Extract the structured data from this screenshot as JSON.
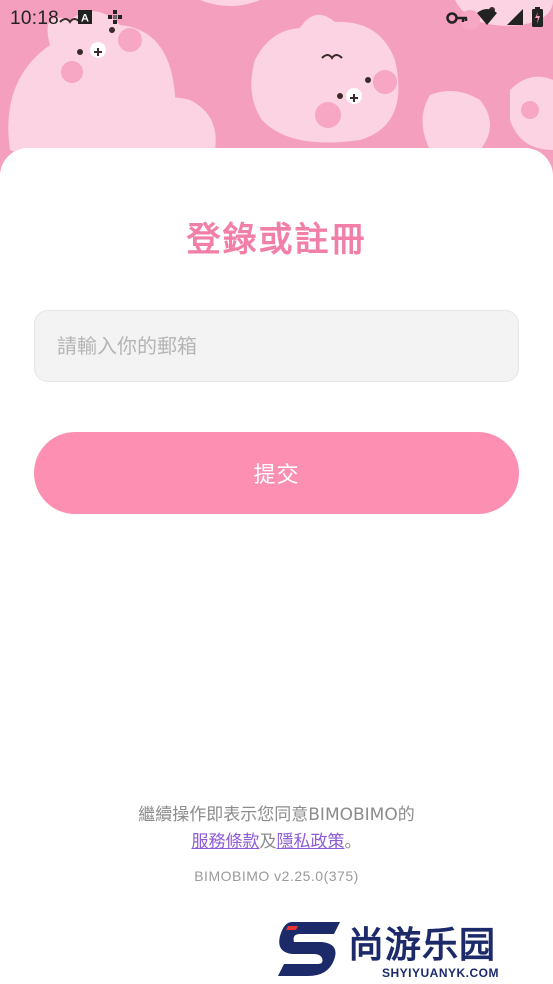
{
  "status_bar": {
    "time": "10:18",
    "left_icons": [
      "app-a-icon",
      "grid-dots-icon"
    ],
    "right_icons": [
      "vpn-key-icon",
      "wifi-icon",
      "signal-icon",
      "battery-icon"
    ]
  },
  "colors": {
    "accent": "#f27fa8",
    "button": "#fd8fb3",
    "hero_background": "#f59fbe",
    "link": "#8e5bd6"
  },
  "login": {
    "title": "登錄或註冊",
    "email_placeholder": "請輸入你的郵箱",
    "email_value": "",
    "submit_label": "提交"
  },
  "footer": {
    "agreement_prefix": "繼續操作即表示您同意BIMOBIMO的",
    "terms_link": "服務條款",
    "conjunction": "及",
    "privacy_link": "隱私政策",
    "suffix": "。",
    "version": "BIMOBIMO v2.25.0(375)"
  },
  "watermark": {
    "title": "尚游乐园",
    "subtitle": "SHYIYUANYK.COM"
  }
}
